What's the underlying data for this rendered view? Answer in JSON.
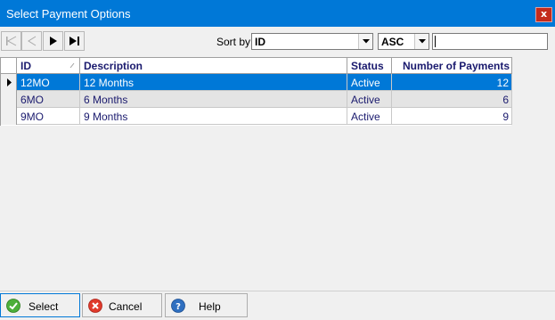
{
  "window": {
    "title": "Select Payment Options",
    "close_label": "x"
  },
  "toolbar": {
    "sort_label": "Sort by",
    "sort_field": "ID",
    "sort_order": "ASC",
    "filter_value": ""
  },
  "grid": {
    "columns": [
      "ID",
      "Description",
      "Status",
      "Number of Payments"
    ],
    "rows": [
      {
        "id": "12MO",
        "description": "12 Months",
        "status": "Active",
        "payments": "12"
      },
      {
        "id": "6MO",
        "description": "6 Months",
        "status": "Active",
        "payments": "6"
      },
      {
        "id": "9MO",
        "description": "9 Months",
        "status": "Active",
        "payments": "9"
      }
    ],
    "selected_row": 0
  },
  "buttons": {
    "select": "Select",
    "cancel": "Cancel",
    "help": "Help"
  },
  "colors": {
    "titlebar": "#0078d7",
    "selection": "#0078d7",
    "close": "#c42b1c"
  }
}
